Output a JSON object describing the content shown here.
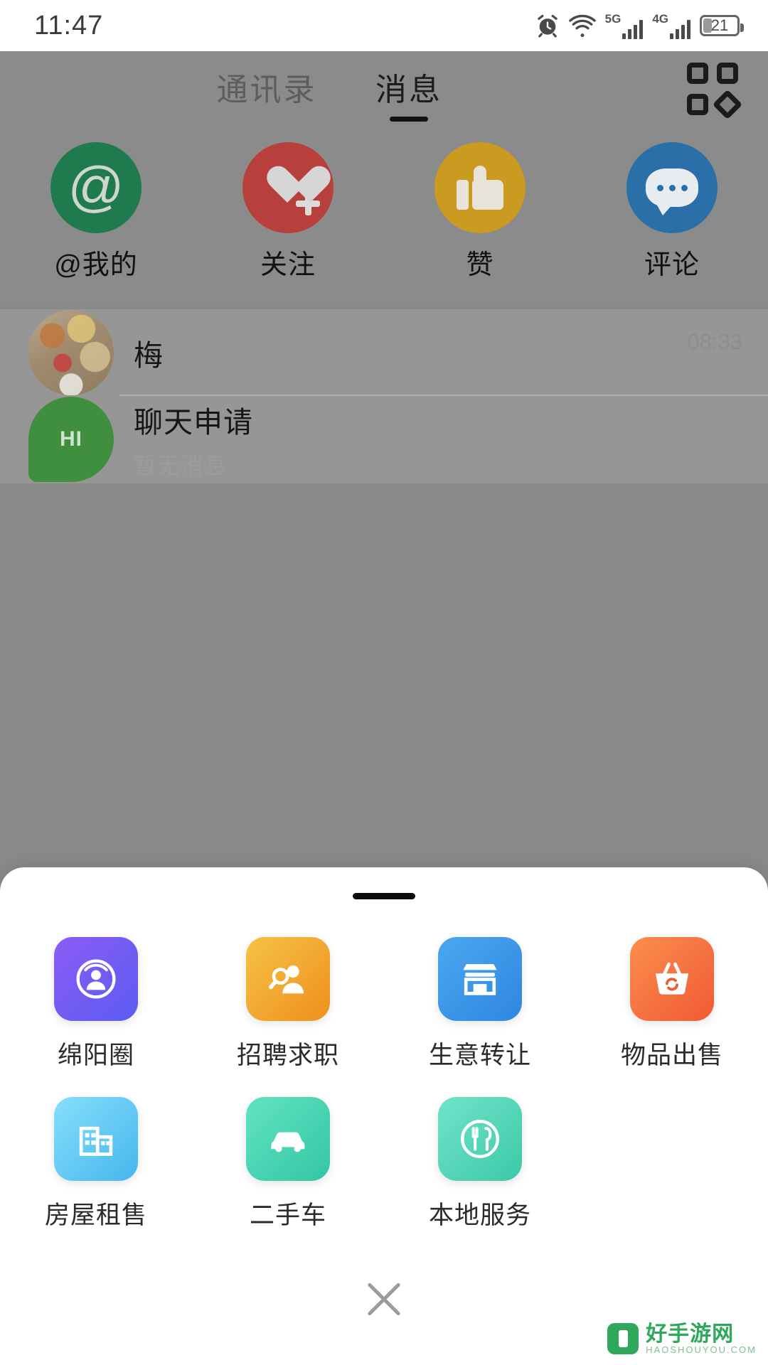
{
  "status_bar": {
    "time": "11:47",
    "icons": [
      "alarm-icon",
      "wifi-icon",
      "signal-5g-icon",
      "signal-4g-icon",
      "battery-icon"
    ],
    "network_5g_label": "5G",
    "network_4g_label": "4G",
    "battery_percent": "21"
  },
  "header": {
    "tabs": [
      {
        "label": "通讯录",
        "active": false
      },
      {
        "label": "消息",
        "active": true
      }
    ],
    "grid_button": "grid-menu-icon"
  },
  "quick_actions": [
    {
      "label": "@我的",
      "icon": "at-icon",
      "color": "#1f7a4d"
    },
    {
      "label": "关注",
      "icon": "heart-plus-icon",
      "color": "#b7403c"
    },
    {
      "label": "赞",
      "icon": "thumbs-up-icon",
      "color": "#cb9a20"
    },
    {
      "label": "评论",
      "icon": "comment-bubble-icon",
      "color": "#2a6fa8"
    }
  ],
  "chat_list": [
    {
      "name": "梅",
      "subtitle": "",
      "time": "08:33",
      "avatar": "photo-avatar"
    },
    {
      "name": "聊天申请",
      "subtitle": "暂无消息",
      "time": "",
      "avatar": "hi-avatar",
      "avatar_text": "HI"
    }
  ],
  "bottom_sheet": {
    "handle": "drag-handle",
    "close_label": "close-icon",
    "items": [
      {
        "label": "绵阳圈",
        "icon": "broadcast-icon",
        "color_from": "#8b5cf6",
        "color_to": "#5b5cf0"
      },
      {
        "label": "招聘求职",
        "icon": "job-search-icon",
        "color_from": "#f6c344",
        "color_to": "#f09020"
      },
      {
        "label": "生意转让",
        "icon": "storefront-icon",
        "color_from": "#4aa8f0",
        "color_to": "#2f86e0"
      },
      {
        "label": "物品出售",
        "icon": "basket-sell-icon",
        "color_from": "#f98a4a",
        "color_to": "#f0603a"
      },
      {
        "label": "房屋租售",
        "icon": "building-icon",
        "color_from": "#7fdcfa",
        "color_to": "#49b8ef"
      },
      {
        "label": "二手车",
        "icon": "car-icon",
        "color_from": "#5fe0c0",
        "color_to": "#36c9a6"
      },
      {
        "label": "本地服务",
        "icon": "dining-icon",
        "color_from": "#6fe0c6",
        "color_to": "#3fcaa8"
      }
    ]
  },
  "watermark": {
    "title": "好手游网",
    "subtitle": "HAOSHOUYOU.COM"
  }
}
